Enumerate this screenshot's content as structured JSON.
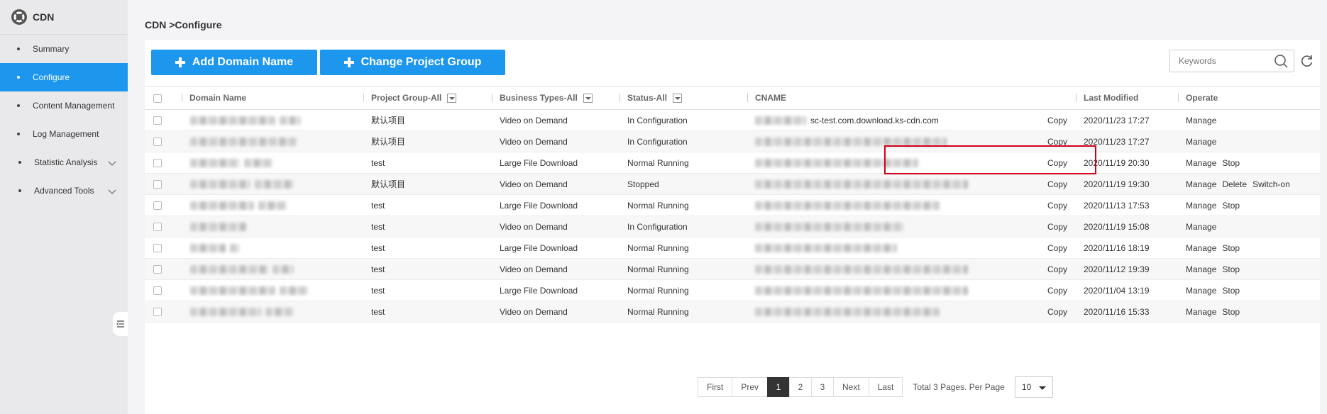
{
  "app": {
    "name": "CDN"
  },
  "sidebar": {
    "items": [
      {
        "label": "Summary",
        "active": false
      },
      {
        "label": "Configure",
        "active": true
      },
      {
        "label": "Content Management",
        "active": false
      },
      {
        "label": "Log Management",
        "active": false
      },
      {
        "label": "Statistic Analysis",
        "active": false,
        "expandable": true
      },
      {
        "label": "Advanced Tools",
        "active": false,
        "expandable": true
      }
    ]
  },
  "breadcrumb": "CDN >Configure",
  "toolbar": {
    "add_domain_label": "Add Domain Name",
    "change_group_label": "Change Project Group",
    "search_placeholder": "Keywords"
  },
  "table": {
    "headers": {
      "domain": "Domain Name",
      "project_group": "Project Group-All",
      "business_types": "Business Types-All",
      "status": "Status-All",
      "cname": "CNAME",
      "last_modified": "Last Modified",
      "operate": "Operate"
    },
    "copy_label": "Copy",
    "rows": [
      {
        "project": "默认项目",
        "business": "Video on Demand",
        "status": "In Configuration",
        "status_type": "config",
        "cname": "sc-test.com.download.ks-cdn.com",
        "modified": "2020/11/23 17:27",
        "ops": [
          "Manage"
        ]
      },
      {
        "project": "默认项目",
        "business": "Video on Demand",
        "status": "In Configuration",
        "status_type": "config",
        "cname": "",
        "modified": "2020/11/23 17:27",
        "ops": [
          "Manage"
        ]
      },
      {
        "project": "test",
        "business": "Large File Download",
        "status": "Normal Running",
        "status_type": "running",
        "cname": "",
        "modified": "2020/11/19 20:30",
        "ops": [
          "Manage",
          "Stop"
        ]
      },
      {
        "project": "默认项目",
        "business": "Video on Demand",
        "status": "Stopped",
        "status_type": "stopped",
        "cname": "",
        "modified": "2020/11/19 19:30",
        "ops": [
          "Manage",
          "Delete",
          "Switch-on"
        ]
      },
      {
        "project": "test",
        "business": "Large File Download",
        "status": "Normal Running",
        "status_type": "running",
        "cname": "",
        "modified": "2020/11/13 17:53",
        "ops": [
          "Manage",
          "Stop"
        ]
      },
      {
        "project": "test",
        "business": "Video on Demand",
        "status": "In Configuration",
        "status_type": "config",
        "cname": "",
        "modified": "2020/11/19 15:08",
        "ops": [
          "Manage"
        ]
      },
      {
        "project": "test",
        "business": "Large File Download",
        "status": "Normal Running",
        "status_type": "running",
        "cname": "",
        "modified": "2020/11/16 18:19",
        "ops": [
          "Manage",
          "Stop"
        ]
      },
      {
        "project": "test",
        "business": "Video on Demand",
        "status": "Normal Running",
        "status_type": "running",
        "cname": "",
        "modified": "2020/11/12 19:39",
        "ops": [
          "Manage",
          "Stop"
        ]
      },
      {
        "project": "test",
        "business": "Large File Download",
        "status": "Normal Running",
        "status_type": "running",
        "cname": "",
        "modified": "2020/11/04 13:19",
        "ops": [
          "Manage",
          "Stop"
        ]
      },
      {
        "project": "test",
        "business": "Video on Demand",
        "status": "Normal Running",
        "status_type": "running",
        "cname": "",
        "modified": "2020/11/16 15:33",
        "ops": [
          "Manage",
          "Stop"
        ]
      }
    ]
  },
  "pagination": {
    "first": "First",
    "prev": "Prev",
    "pages": [
      "1",
      "2",
      "3"
    ],
    "current": "1",
    "next": "Next",
    "last": "Last",
    "summary": "Total 3 Pages. Per Page",
    "per_page": "10"
  },
  "colors": {
    "accent": "#1d97ee",
    "config": "#f08a24",
    "running": "#2a7ccf",
    "stopped": "#d33a2c",
    "highlight": "#d0021b"
  },
  "icons": {
    "logo": "lifebuoy-icon",
    "search": "search-icon",
    "refresh": "refresh-icon",
    "chevron": "chevron-down-icon",
    "filter": "filter-dropdown-icon",
    "plus": "plus-icon",
    "collapse": "menu-collapse-icon"
  }
}
